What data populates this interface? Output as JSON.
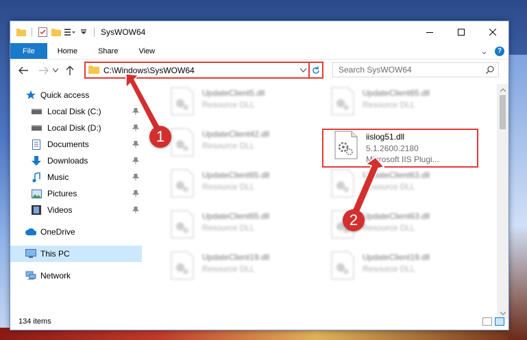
{
  "window": {
    "title": "SysWOW64",
    "minimize_glyph": "—",
    "maximize_glyph": "☐",
    "close_glyph": "✕"
  },
  "ribbon": {
    "tabs": [
      "File",
      "Home",
      "Share",
      "View"
    ],
    "expand_glyph": "⌄",
    "help_glyph": "?"
  },
  "address": {
    "path": "C:\\Windows\\SysWOW64",
    "dropdown_glyph": "⌄",
    "refresh_glyph": "↻"
  },
  "search": {
    "placeholder": "Search SysWOW64"
  },
  "sidebar": {
    "items": [
      {
        "label": "Quick access",
        "icon": "star-icon",
        "pinned": false,
        "selected": false
      },
      {
        "label": "Local Disk (C:)",
        "icon": "drive-icon",
        "pinned": true,
        "selected": false
      },
      {
        "label": "Local Disk (D:)",
        "icon": "drive-icon",
        "pinned": true,
        "selected": false
      },
      {
        "label": "Documents",
        "icon": "documents-icon",
        "pinned": true,
        "selected": false
      },
      {
        "label": "Downloads",
        "icon": "downloads-icon",
        "pinned": true,
        "selected": false
      },
      {
        "label": "Music",
        "icon": "music-icon",
        "pinned": true,
        "selected": false
      },
      {
        "label": "Pictures",
        "icon": "pictures-icon",
        "pinned": true,
        "selected": false
      },
      {
        "label": "Videos",
        "icon": "videos-icon",
        "pinned": true,
        "selected": false
      },
      {
        "label": "OneDrive",
        "icon": "cloud-icon",
        "pinned": false,
        "selected": false
      },
      {
        "label": "This PC",
        "icon": "computer-icon",
        "pinned": false,
        "selected": true
      },
      {
        "label": "Network",
        "icon": "network-icon",
        "pinned": false,
        "selected": false
      }
    ]
  },
  "files": [
    {
      "name": "UpdateClient5.dll",
      "meta": "Resource DLL",
      "blurred": true
    },
    {
      "name": "UpdateClient65.dll",
      "meta": "Resource DLL",
      "blurred": true
    },
    {
      "name": "UpdateClient42.dll",
      "meta": "Resource DLL",
      "blurred": true
    },
    {
      "name": "iislog51.dll",
      "meta": "5.1.2600.2180",
      "meta2": "Microsoft IIS Plugi...",
      "blurred": false
    },
    {
      "name": "UpdateClient65.dll",
      "meta": "Resource DLL",
      "blurred": true
    },
    {
      "name": "UpdateClient63.dll",
      "meta": "Resource DLL",
      "blurred": true
    },
    {
      "name": "UpdateClient65.dll",
      "meta": "Resource DLL",
      "blurred": true
    },
    {
      "name": "UpdateClient63.dll",
      "meta": "Resource DLL",
      "blurred": true
    },
    {
      "name": "UpdateClient19.dll",
      "meta": "Resource DLL",
      "blurred": true
    },
    {
      "name": "UpdateClient19.dll",
      "meta": "Resource DLL",
      "blurred": true
    }
  ],
  "status": {
    "item_count": "134 items"
  },
  "annotations": {
    "step1": "1",
    "step2": "2",
    "accent_color": "#d32f2f"
  }
}
